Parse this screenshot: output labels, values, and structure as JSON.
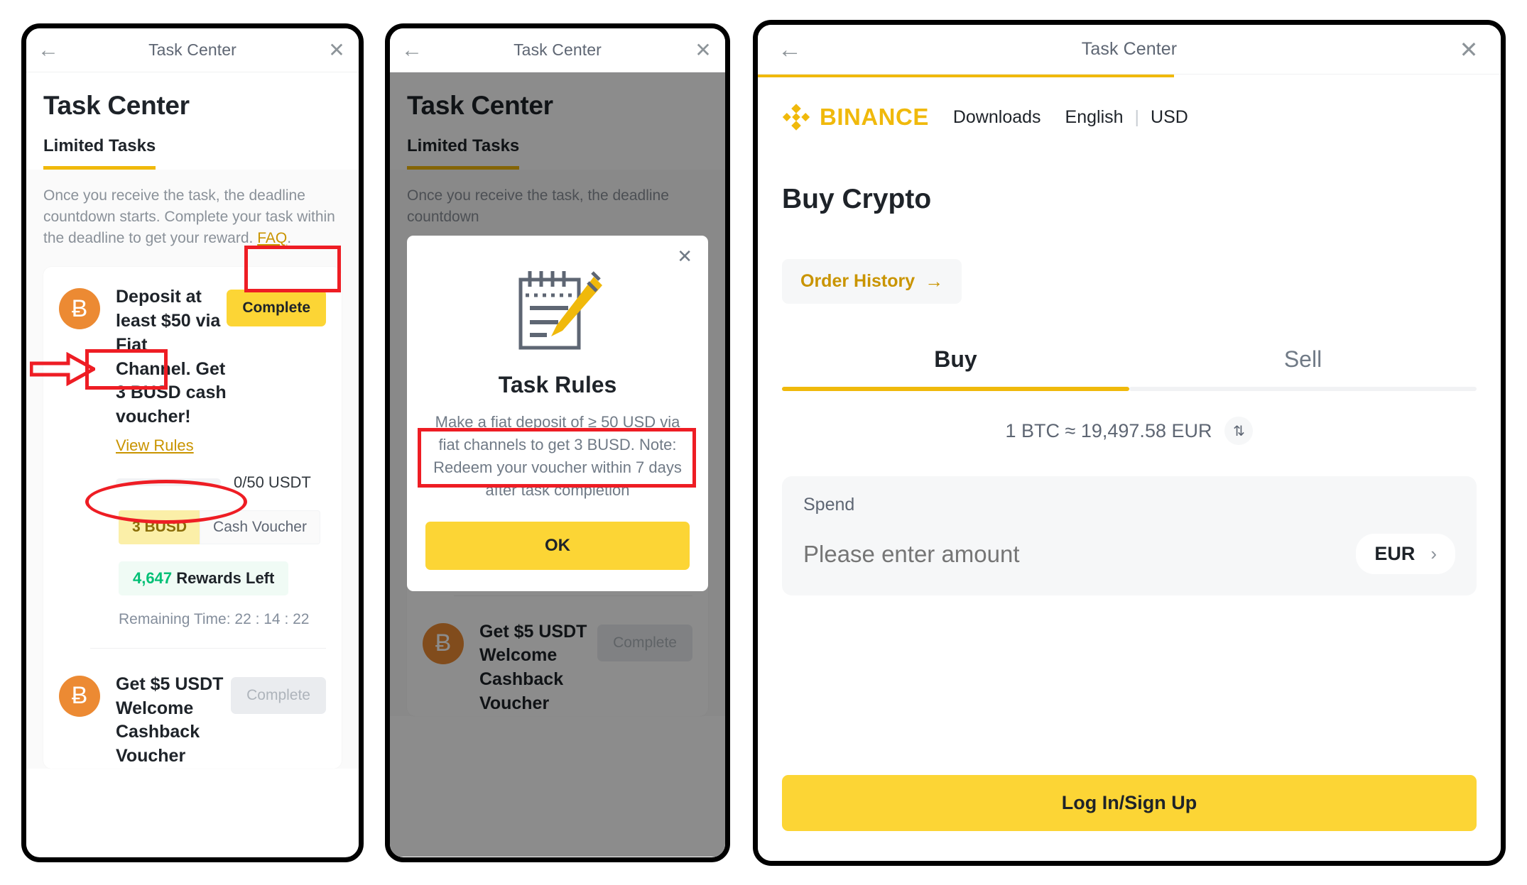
{
  "panel1": {
    "topbar": {
      "back_icon": "arrow-left-icon",
      "title": "Task Center",
      "close_icon": "close-icon"
    },
    "heading": "Task Center",
    "tab": "Limited Tasks",
    "intro": "Once you receive the task, the deadline countdown starts. Complete your task within the deadline to get your reward. ",
    "intro_link": "FAQ",
    "intro_tail": ".",
    "tasks": [
      {
        "coin_symbol": "Ƀ",
        "title": "Deposit at least $50 via Fiat Channel. Get 3 BUSD cash voucher!",
        "link": "View Rules",
        "button": "Complete",
        "button_state": "enabled",
        "progress_label": "0/50 USDT",
        "progress_percent": 0,
        "pill_amount": "3 BUSD",
        "pill_kind": "Cash Voucher",
        "rewards_count": "4,647",
        "rewards_label": "Rewards Left",
        "remaining": "Remaining Time: 22 : 14 : 22"
      },
      {
        "coin_symbol": "Ƀ",
        "title": "Get $5 USDT Welcome Cashback Voucher",
        "button": "Complete",
        "button_state": "disabled"
      }
    ]
  },
  "panel2": {
    "topbar": {
      "back_icon": "arrow-left-icon",
      "title": "Task Center",
      "close_icon": "close-icon"
    },
    "heading": "Task Center",
    "tab": "Limited Tasks",
    "intro": "Once you receive the task, the deadline countdown",
    "modal": {
      "close_icon": "close-icon",
      "icon": "notepad-pencil-icon",
      "title": "Task Rules",
      "body": "Make a fiat deposit of ≥ 50 USD via fiat channels to get 3 BUSD. Note: Redeem your voucher within 7 days after task completion",
      "ok": "OK"
    },
    "bottom_task": {
      "coin_symbol": "Ƀ",
      "title": "Get $5 USDT Welcome Cashback Voucher",
      "button": "Complete"
    }
  },
  "panel3": {
    "topbar": {
      "back_icon": "arrow-left-icon",
      "title": "Task Center",
      "close_icon": "close-icon"
    },
    "brand": "BINANCE",
    "nav": {
      "downloads": "Downloads",
      "language": "English",
      "separator": "|",
      "currency": "USD"
    },
    "heading": "Buy Crypto",
    "order_history": "Order History",
    "order_history_arrow": "→",
    "tab_buy": "Buy",
    "tab_sell": "Sell",
    "rate": "1 BTC ≈ 19,497.58 EUR",
    "swap_icon": "swap-vertical-icon",
    "spend_label": "Spend",
    "spend_placeholder": "Please enter amount",
    "currency": "EUR",
    "chevron": "›",
    "login_button": "Log In/Sign Up"
  },
  "colors": {
    "binance_yellow": "#f0b90b",
    "button_yellow": "#fcd535",
    "annotation_red": "#ee1d24",
    "bitcoin_orange": "#ec8a33",
    "green": "#02c076"
  }
}
